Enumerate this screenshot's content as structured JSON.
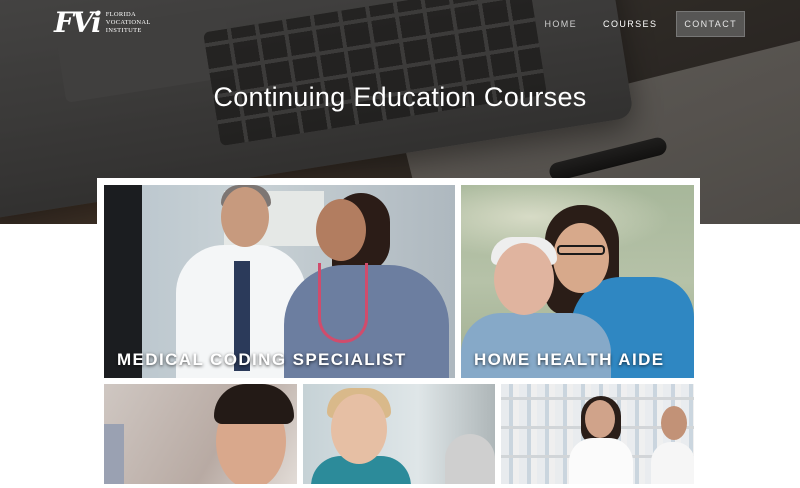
{
  "brand": {
    "mark": "FVi",
    "line1": "Florida",
    "line2": "Vocational",
    "line3": "Institute"
  },
  "nav": {
    "items": [
      {
        "label": "HOME",
        "active": false
      },
      {
        "label": "COURSES",
        "active": true
      },
      {
        "label": "CONTACT",
        "active": false
      }
    ]
  },
  "hero": {
    "title": "Continuing Education Courses"
  },
  "courses": [
    {
      "label": "MEDICAL CODING SPECIALIST"
    },
    {
      "label": "HOME HEALTH AIDE"
    },
    {
      "label": ""
    },
    {
      "label": ""
    },
    {
      "label": ""
    }
  ]
}
